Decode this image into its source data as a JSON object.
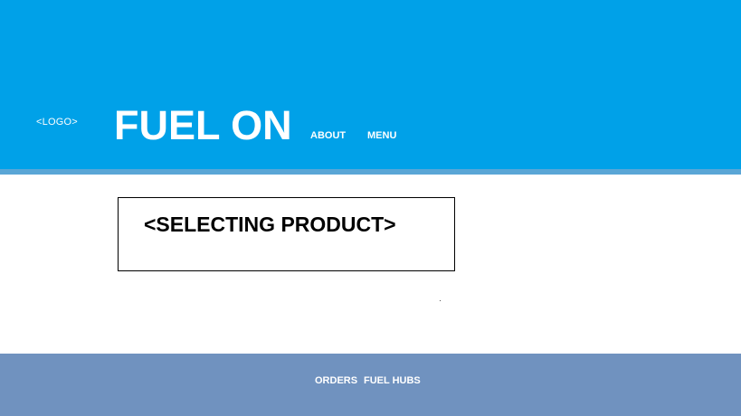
{
  "header": {
    "logo_text": "<LOGO>",
    "brand": "FUEL ON",
    "nav": {
      "about": "ABOUT",
      "menu": "MENU"
    },
    "background_color": "#00a1e8"
  },
  "main": {
    "product_placeholder": "<SELECTING PRODUCT>"
  },
  "footer": {
    "links": {
      "orders": "ORDERS",
      "fuel_hubs": "FUEL HUBS"
    },
    "background_color": "#7092bf"
  }
}
